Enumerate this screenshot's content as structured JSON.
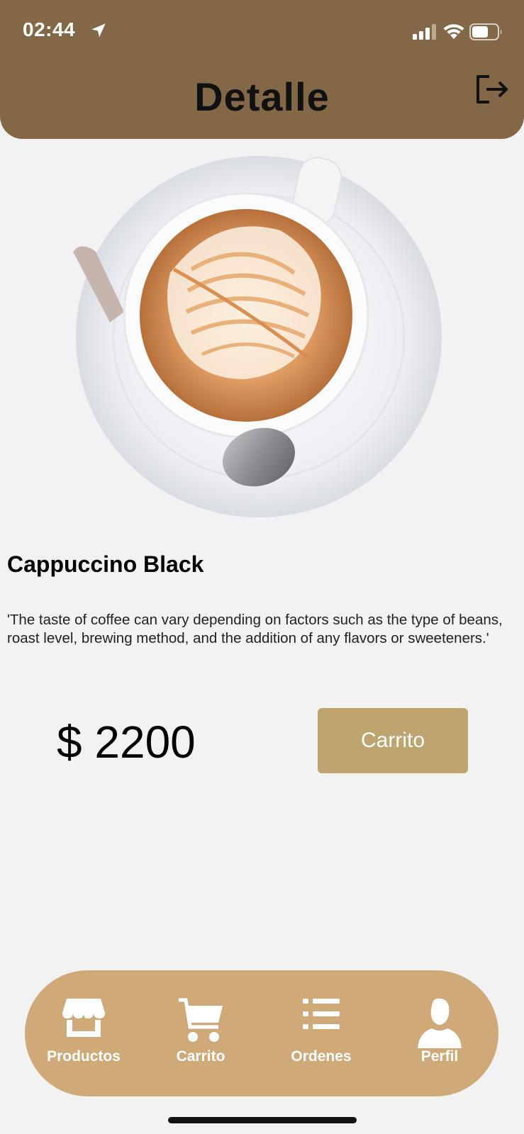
{
  "status_bar": {
    "time": "02:44"
  },
  "header": {
    "title": "Detalle"
  },
  "product": {
    "name": "Cappuccino Black",
    "description": "'The taste of coffee can vary depending on factors such as the type of beans, roast level, brewing method, and the addition of any flavors or sweeteners.'",
    "price": "$ 2200",
    "cart_button_label": "Carrito"
  },
  "tabs": [
    {
      "label": "Productos",
      "icon": "store-icon"
    },
    {
      "label": "Carrito",
      "icon": "cart-icon"
    },
    {
      "label": "Ordenes",
      "icon": "list-icon"
    },
    {
      "label": "Perfil",
      "icon": "person-icon"
    }
  ],
  "colors": {
    "header": "#836847",
    "button": "#bea46e",
    "tabbar": "#cfa978",
    "background": "#f2f2f2"
  }
}
